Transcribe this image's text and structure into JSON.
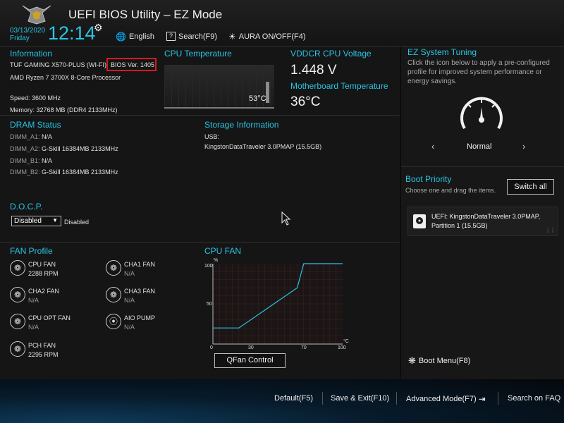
{
  "header": {
    "title": "UEFI BIOS Utility – EZ Mode",
    "date": "03/13/2020",
    "day": "Friday",
    "time": "12:14",
    "language": "English",
    "search": "Search(F9)",
    "aura": "AURA ON/OFF(F4)"
  },
  "information": {
    "heading": "Information",
    "board": "TUF GAMING X570-PLUS (WI-FI)",
    "bios_version": "BIOS Ver. 1405",
    "cpu": "AMD Ryzen 7 3700X 8-Core Processor",
    "speed": "Speed: 3600 MHz",
    "memory": "Memory: 32768 MB (DDR4 2133MHz)"
  },
  "cpu_temp": {
    "heading": "CPU Temperature",
    "value": "53°C"
  },
  "voltage": {
    "heading": "VDDCR CPU Voltage",
    "value": "1.448 V"
  },
  "mb_temp": {
    "heading": "Motherboard Temperature",
    "value": "36°C"
  },
  "dram": {
    "heading": "DRAM Status",
    "slots": [
      {
        "label": "DIMM_A1:",
        "value": "N/A"
      },
      {
        "label": "DIMM_A2:",
        "value": "G-Skill 16384MB 2133MHz"
      },
      {
        "label": "DIMM_B1:",
        "value": "N/A"
      },
      {
        "label": "DIMM_B2:",
        "value": "G-Skill 16384MB 2133MHz"
      }
    ]
  },
  "storage": {
    "heading": "Storage Information",
    "usb_label": "USB:",
    "device": "KingstonDataTraveler 3.0PMAP (15.5GB)"
  },
  "docp": {
    "heading": "D.O.C.P.",
    "selected": "Disabled",
    "status": "Disabled"
  },
  "fan_profile": {
    "heading": "FAN Profile",
    "fans": [
      {
        "name": "CPU FAN",
        "value": "2288 RPM"
      },
      {
        "name": "CHA1 FAN",
        "value": "N/A"
      },
      {
        "name": "CHA2 FAN",
        "value": "N/A"
      },
      {
        "name": "CHA3 FAN",
        "value": "N/A"
      },
      {
        "name": "CPU OPT FAN",
        "value": "N/A"
      },
      {
        "name": "AIO PUMP",
        "value": "N/A"
      },
      {
        "name": "PCH FAN",
        "value": "2295 RPM"
      }
    ]
  },
  "cpu_fan": {
    "heading": "CPU FAN",
    "y_unit": "%",
    "x_unit": "°C",
    "y_ticks": [
      "100",
      "50"
    ],
    "x_ticks": [
      "0",
      "30",
      "70",
      "100"
    ],
    "qfan_button": "QFan Control",
    "curve": [
      [
        0,
        20
      ],
      [
        20,
        20
      ],
      [
        65,
        70
      ],
      [
        70,
        100
      ],
      [
        100,
        100
      ]
    ]
  },
  "ez_tuning": {
    "heading": "EZ System Tuning",
    "description": "Click the icon below to apply a pre-configured profile for improved system performance or energy savings.",
    "mode": "Normal"
  },
  "boot_priority": {
    "heading": "Boot Priority",
    "subtext": "Choose one and drag the items.",
    "switch_all": "Switch all",
    "device_line1": "UEFI: KingstonDataTraveler 3.0PMAP,",
    "device_line2": "Partition 1 (15.5GB)",
    "boot_menu": "Boot Menu(F8)"
  },
  "footer": {
    "default": "Default(F5)",
    "save_exit": "Save & Exit(F10)",
    "advanced": "Advanced Mode(F7)",
    "search_faq": "Search on FAQ"
  },
  "colors": {
    "accent": "#29c4e3",
    "highlight": "#d71920"
  }
}
